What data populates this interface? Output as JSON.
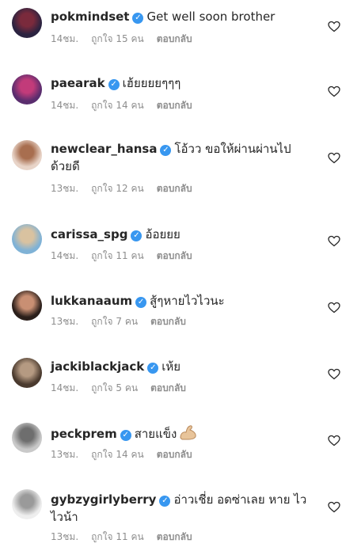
{
  "comments": [
    {
      "username": "pokmindset",
      "text": "Get well soon brother",
      "time": "14ชม.",
      "likes": "ถูกใจ 15 คน",
      "reply": "ตอบกลับ",
      "avatar_color": "#2b2340",
      "avatar_accent": "#7a2a3c"
    },
    {
      "username": "paearak",
      "text": "เฮ้ยยยยๆๆๆ",
      "time": "14ชม.",
      "likes": "ถูกใจ 14 คน",
      "reply": "ตอบกลับ",
      "avatar_color": "#5a2d6e",
      "avatar_accent": "#c23b7a"
    },
    {
      "username": "newclear_hansa",
      "text": "โอ้วว ขอให้ผ่านผ่านไป ด้วยดี",
      "time": "13ชม.",
      "likes": "ถูกใจ 12 คน",
      "reply": "ตอบกลับ",
      "avatar_color": "#e8d4c8",
      "avatar_accent": "#a86e4f"
    },
    {
      "username": "carissa_spg",
      "text": "อ้อยยย",
      "time": "14ชม.",
      "likes": "ถูกใจ 11 คน",
      "reply": "ตอบกลับ",
      "avatar_color": "#7fb2d6",
      "avatar_accent": "#d9c2a0"
    },
    {
      "username": "lukkanaaum",
      "text": "สู้ๆหายไวไวนะ",
      "time": "13ชม.",
      "likes": "ถูกใจ 7 คน",
      "reply": "ตอบกลับ",
      "avatar_color": "#2a1e1a",
      "avatar_accent": "#c98f73"
    },
    {
      "username": "jackiblackjack",
      "text": "เห้ย",
      "time": "14ชม.",
      "likes": "ถูกใจ 5 คน",
      "reply": "ตอบกลับ",
      "avatar_color": "#4a3a2e",
      "avatar_accent": "#b59a82"
    },
    {
      "username": "peckprem",
      "text": "สายแข็ง",
      "emoji": "flexed-biceps-icon",
      "time": "13ชม.",
      "likes": "ถูกใจ 14 คน",
      "reply": "ตอบกลับ",
      "avatar_color": "#c9c9c9",
      "avatar_accent": "#6e6e6e"
    },
    {
      "username": "gybzygirlyberry",
      "text": "อ่าวเชี่ย อดซ่าเลย หาย ไวไวน้า",
      "time": "13ชม.",
      "likes": "ถูกใจ 11 คน",
      "reply": "ตอบกลับ",
      "avatar_color": "#eeeeee",
      "avatar_accent": "#9a9a9a"
    }
  ],
  "icons": {
    "verified": "verified-badge-icon",
    "like": "heart-outline-icon"
  },
  "colors": {
    "verified": "#3897f0",
    "meta": "#8e8e8e",
    "text": "#262626"
  }
}
